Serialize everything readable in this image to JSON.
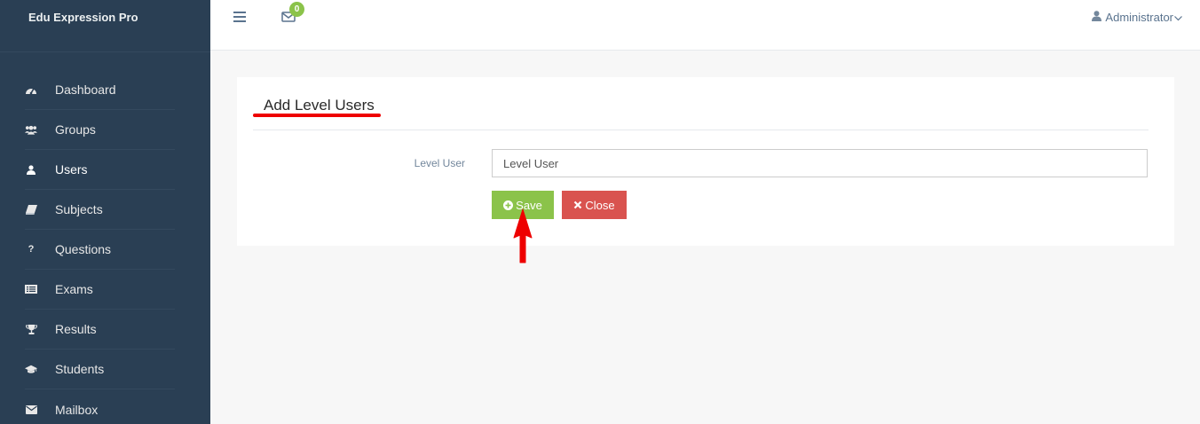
{
  "app": {
    "title": "Edu Expression Pro"
  },
  "sidebar": {
    "items": [
      {
        "label": "Dashboard",
        "icon": "dashboard-icon"
      },
      {
        "label": "Groups",
        "icon": "groups-icon"
      },
      {
        "label": "Users",
        "icon": "user-icon"
      },
      {
        "label": "Subjects",
        "icon": "book-icon"
      },
      {
        "label": "Questions",
        "icon": "question-icon"
      },
      {
        "label": "Exams",
        "icon": "exam-list-icon"
      },
      {
        "label": "Results",
        "icon": "trophy-icon"
      },
      {
        "label": "Students",
        "icon": "graduation-cap-icon"
      },
      {
        "label": "Mailbox",
        "icon": "envelope-icon"
      }
    ],
    "active": "Users"
  },
  "topnav": {
    "mail_count": "0",
    "user_name": "Administrator"
  },
  "form": {
    "title": "Add Level Users",
    "field_label": "Level User",
    "field_placeholder": "Level User",
    "save_label": "Save",
    "close_label": "Close"
  },
  "colors": {
    "sidebar_bg": "#2a3f54",
    "save_button": "#8bc34a",
    "close_button": "#d9534f",
    "annotation": "#ee0000"
  }
}
